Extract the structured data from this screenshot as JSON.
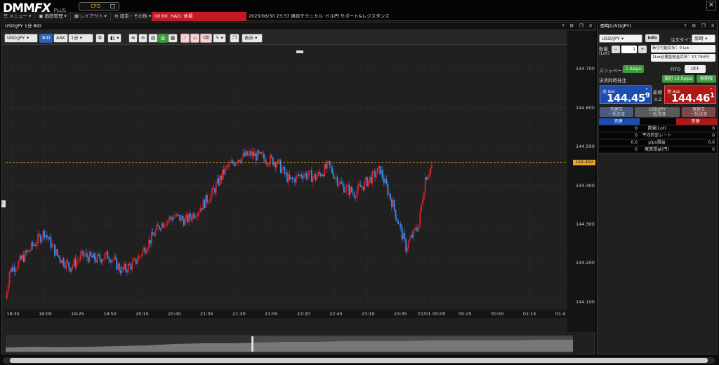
{
  "app": {
    "logo_main": "DMM",
    "logo_fx": "FX",
    "logo_plus": "PLUS",
    "cfd_label": "CFD",
    "menu": [
      "メニュー",
      "画面管理",
      "レイアウト",
      "設定・その他"
    ],
    "ticker_time": "00:00",
    "ticker_text": "HAD. 休場",
    "news": "2025/06/30 23:37  週足テクニカル･ドル円  サポート&レジスタンス"
  },
  "chart_panel": {
    "title": "USD/JPY 1分 BID",
    "toolbar": {
      "pair": "USD/JPY",
      "bid": "BID",
      "ask": "ASK",
      "interval": "1分",
      "display": "表示"
    },
    "price_ticks": [
      "144.700",
      "144.600",
      "144.500",
      "144.400",
      "144.300",
      "144.200",
      "144.100"
    ],
    "time_ticks": [
      "18:35",
      "19:00",
      "19:25",
      "19:50",
      "20:15",
      "20:40",
      "21:05",
      "21:30",
      "21:55",
      "22:20",
      "22:45",
      "23:10",
      "23:35",
      "07/01 00:00",
      "00:25",
      "00:50",
      "01:15",
      "01:4"
    ],
    "current_price": "144.459",
    "colors": {
      "up": "#e0202a",
      "down": "#2f8ef0",
      "price_line": "#d89a2a"
    }
  },
  "chart_data": {
    "type": "candlestick",
    "title": "USD/JPY 1分 BID",
    "ylim": [
      144.08,
      144.74
    ],
    "x_start": "18:30",
    "x_end": "01:45",
    "interval_minutes": 1,
    "close_path": [
      {
        "t": "18:30",
        "v": 144.11
      },
      {
        "t": "18:33",
        "v": 144.18
      },
      {
        "t": "18:40",
        "v": 144.2
      },
      {
        "t": "18:50",
        "v": 144.24
      },
      {
        "t": "19:00",
        "v": 144.28
      },
      {
        "t": "19:10",
        "v": 144.22
      },
      {
        "t": "19:20",
        "v": 144.19
      },
      {
        "t": "19:30",
        "v": 144.22
      },
      {
        "t": "19:40",
        "v": 144.21
      },
      {
        "t": "19:50",
        "v": 144.22
      },
      {
        "t": "20:00",
        "v": 144.18
      },
      {
        "t": "20:10",
        "v": 144.2
      },
      {
        "t": "20:20",
        "v": 144.25
      },
      {
        "t": "20:30",
        "v": 144.3
      },
      {
        "t": "20:40",
        "v": 144.32
      },
      {
        "t": "20:50",
        "v": 144.31
      },
      {
        "t": "21:00",
        "v": 144.34
      },
      {
        "t": "21:10",
        "v": 144.38
      },
      {
        "t": "21:20",
        "v": 144.44
      },
      {
        "t": "21:30",
        "v": 144.47
      },
      {
        "t": "21:40",
        "v": 144.48
      },
      {
        "t": "21:50",
        "v": 144.47
      },
      {
        "t": "22:00",
        "v": 144.46
      },
      {
        "t": "22:10",
        "v": 144.41
      },
      {
        "t": "22:20",
        "v": 144.43
      },
      {
        "t": "22:30",
        "v": 144.42
      },
      {
        "t": "22:40",
        "v": 144.45
      },
      {
        "t": "22:50",
        "v": 144.4
      },
      {
        "t": "23:00",
        "v": 144.38
      },
      {
        "t": "23:10",
        "v": 144.41
      },
      {
        "t": "23:20",
        "v": 144.44
      },
      {
        "t": "23:30",
        "v": 144.35
      },
      {
        "t": "23:40",
        "v": 144.24
      },
      {
        "t": "23:50",
        "v": 144.3
      },
      {
        "t": "23:55",
        "v": 144.42
      },
      {
        "t": "00:00",
        "v": 144.45
      }
    ]
  },
  "order_panel": {
    "title": "即時(USD/JPY)",
    "pair": "USD/JPY",
    "info": "info",
    "order_type_label": "注文タイプ",
    "order_type": "即時",
    "qty_label": "数量",
    "qty_unit": "(Lot)",
    "qty_value": "1",
    "max_lots": "新引可能目安：0 Lot",
    "margin": "1Lot必要証拠金目安：57,784円",
    "slippage_label": "スリッページ",
    "slippage_value": "1.0pips",
    "fifo_label": "FIFO",
    "fifo_value": "OFF",
    "settle_label": "決済同時発注",
    "loss_cut": "損切 10.0pips",
    "unlimited": "無期限",
    "bid_label": "売 Bid",
    "bid_price_main": "144.45",
    "bid_price_last": "9",
    "spread_label": "新規",
    "spread_value": "0.2",
    "ask_label": "買 Ask",
    "ask_price_main": "144.46",
    "ask_price_last": "1",
    "sell_settle": "売建玉\n一括決済",
    "pair_settle": "USD/JPY\n一括決済",
    "buy_settle": "買建玉\n一括決済",
    "sell_head": "売建",
    "buy_head": "買建",
    "positions": [
      {
        "sell": "0",
        "label": "数量(Lot)",
        "buy": "0"
      },
      {
        "sell": "0",
        "label": "平均約定レート",
        "buy": "0"
      },
      {
        "sell": "0.0",
        "label": "pips損益",
        "buy": "0.0"
      },
      {
        "sell": "0",
        "label": "概算損益(円)",
        "buy": "0"
      }
    ]
  }
}
